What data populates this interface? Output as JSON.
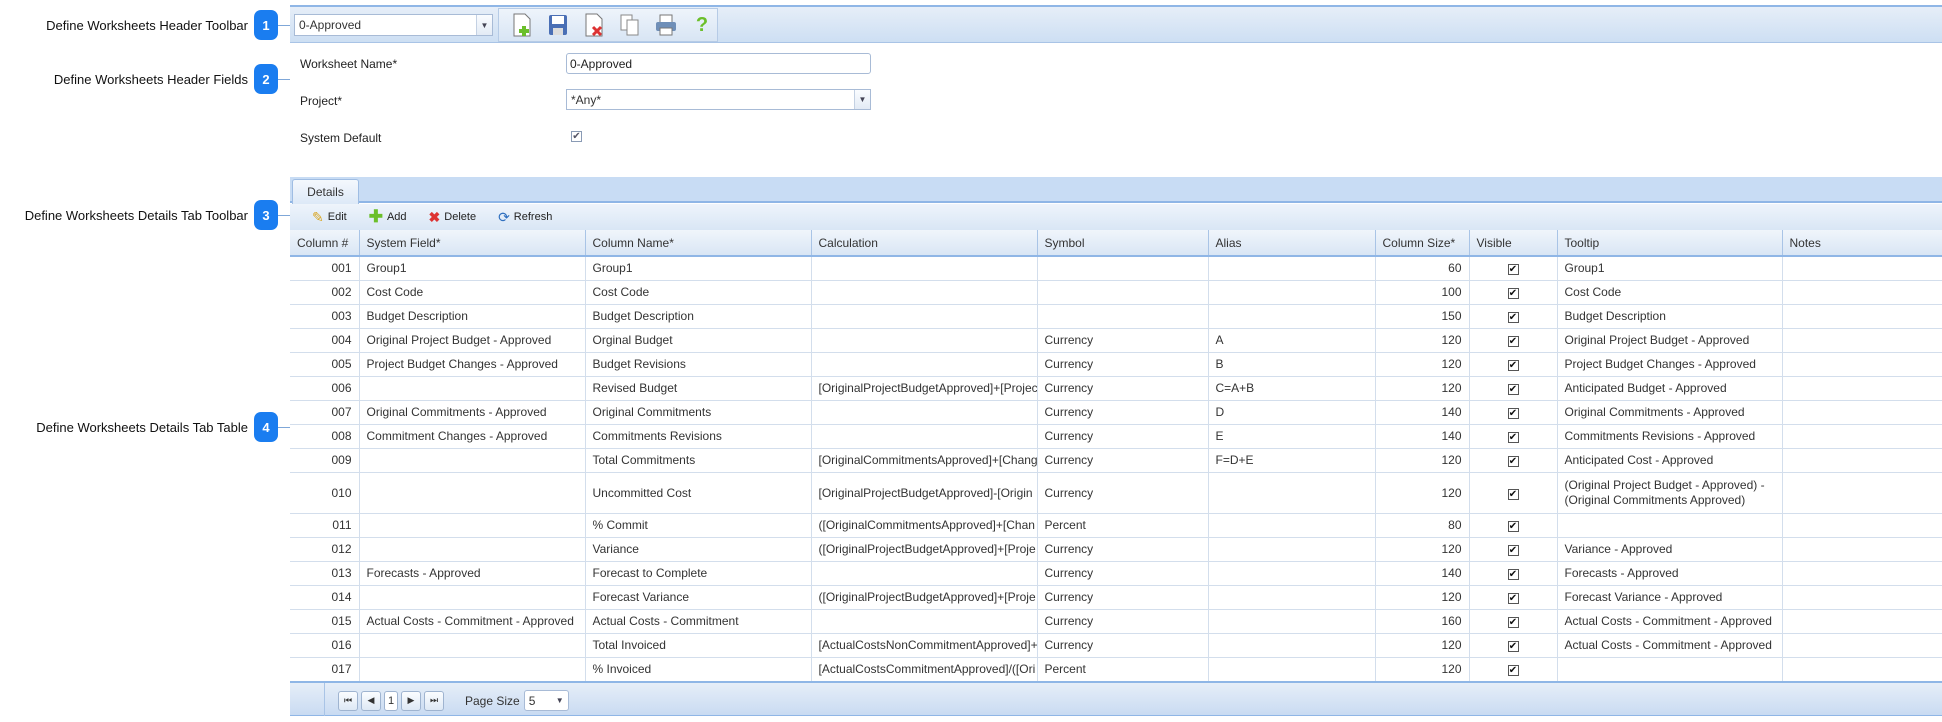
{
  "callouts": [
    {
      "number": "1",
      "label": "Define Worksheets Header Toolbar"
    },
    {
      "number": "2",
      "label": "Define Worksheets Header Fields"
    },
    {
      "number": "3",
      "label": "Define Worksheets Details Tab Toolbar"
    },
    {
      "number": "4",
      "label": "Define Worksheets Details Tab Table"
    }
  ],
  "header_toolbar": {
    "worksheet_select": "0-Approved",
    "icons": [
      "new-document-icon",
      "save-icon",
      "delete-document-icon",
      "copy-icon",
      "print-icon",
      "help-icon"
    ]
  },
  "header_fields": {
    "worksheet_name_label": "Worksheet Name*",
    "worksheet_name_value": "0-Approved",
    "project_label": "Project*",
    "project_value": "*Any*",
    "system_default_label": "System Default",
    "system_default_checked": true
  },
  "tabs": [
    {
      "label": "Details",
      "active": true
    }
  ],
  "details_toolbar": {
    "edit": "Edit",
    "add": "Add",
    "delete": "Delete",
    "refresh": "Refresh"
  },
  "table": {
    "columns": [
      "Column #",
      "System Field*",
      "Column Name*",
      "Calculation",
      "Symbol",
      "Alias",
      "Column Size*",
      "Visible",
      "Tooltip",
      "Notes"
    ],
    "rows": [
      {
        "num": "001",
        "system_field": "Group1",
        "column_name": "Group1",
        "calculation": "",
        "symbol": "",
        "alias": "",
        "size": "60",
        "visible": true,
        "tooltip": "Group1",
        "notes": ""
      },
      {
        "num": "002",
        "system_field": "Cost Code",
        "column_name": "Cost Code",
        "calculation": "",
        "symbol": "",
        "alias": "",
        "size": "100",
        "visible": true,
        "tooltip": "Cost Code",
        "notes": ""
      },
      {
        "num": "003",
        "system_field": "Budget Description",
        "column_name": "Budget Description",
        "calculation": "",
        "symbol": "",
        "alias": "",
        "size": "150",
        "visible": true,
        "tooltip": "Budget Description",
        "notes": ""
      },
      {
        "num": "004",
        "system_field": "Original Project Budget - Approved",
        "column_name": "Orginal Budget",
        "calculation": "",
        "symbol": "Currency",
        "alias": "A",
        "size": "120",
        "visible": true,
        "tooltip": "Original Project Budget - Approved",
        "notes": ""
      },
      {
        "num": "005",
        "system_field": "Project Budget Changes - Approved",
        "column_name": "Budget Revisions",
        "calculation": "",
        "symbol": "Currency",
        "alias": "B",
        "size": "120",
        "visible": true,
        "tooltip": "Project Budget Changes - Approved",
        "notes": ""
      },
      {
        "num": "006",
        "system_field": "",
        "column_name": "Revised Budget",
        "calculation": "[OriginalProjectBudgetApproved]+[Projec",
        "symbol": "Currency",
        "alias": "C=A+B",
        "size": "120",
        "visible": true,
        "tooltip": "Anticipated Budget - Approved",
        "notes": ""
      },
      {
        "num": "007",
        "system_field": "Original Commitments - Approved",
        "column_name": "Original Commitments",
        "calculation": "",
        "symbol": "Currency",
        "alias": "D",
        "size": "140",
        "visible": true,
        "tooltip": "Original Commitments - Approved",
        "notes": ""
      },
      {
        "num": "008",
        "system_field": "Commitment Changes - Approved",
        "column_name": "Commitments Revisions",
        "calculation": "",
        "symbol": "Currency",
        "alias": "E",
        "size": "140",
        "visible": true,
        "tooltip": "Commitments Revisions - Approved",
        "notes": ""
      },
      {
        "num": "009",
        "system_field": "",
        "column_name": "Total Commitments",
        "calculation": "[OriginalCommitmentsApproved]+[Chang",
        "symbol": "Currency",
        "alias": "F=D+E",
        "size": "120",
        "visible": true,
        "tooltip": "Anticipated Cost - Approved",
        "notes": ""
      },
      {
        "num": "010",
        "system_field": "",
        "column_name": "Uncommitted Cost",
        "calculation": "[OriginalProjectBudgetApproved]-[Origin",
        "symbol": "Currency",
        "alias": "",
        "size": "120",
        "visible": true,
        "tooltip": "(Original Project Budget - Approved) - (Original Commitments Approved)",
        "notes": ""
      },
      {
        "num": "011",
        "system_field": "",
        "column_name": "% Commit",
        "calculation": "([OriginalCommitmentsApproved]+[Chan",
        "symbol": "Percent",
        "alias": "",
        "size": "80",
        "visible": true,
        "tooltip": "",
        "notes": ""
      },
      {
        "num": "012",
        "system_field": "",
        "column_name": "Variance",
        "calculation": "([OriginalProjectBudgetApproved]+[Proje",
        "symbol": "Currency",
        "alias": "",
        "size": "120",
        "visible": true,
        "tooltip": "Variance - Approved",
        "notes": ""
      },
      {
        "num": "013",
        "system_field": "Forecasts - Approved",
        "column_name": "Forecast to Complete",
        "calculation": "",
        "symbol": "Currency",
        "alias": "",
        "size": "140",
        "visible": true,
        "tooltip": "Forecasts - Approved",
        "notes": ""
      },
      {
        "num": "014",
        "system_field": "",
        "column_name": "Forecast Variance",
        "calculation": "([OriginalProjectBudgetApproved]+[Proje",
        "symbol": "Currency",
        "alias": "",
        "size": "120",
        "visible": true,
        "tooltip": "Forecast Variance - Approved",
        "notes": ""
      },
      {
        "num": "015",
        "system_field": "Actual Costs - Commitment - Approved",
        "column_name": "Actual Costs - Commitment",
        "calculation": "",
        "symbol": "Currency",
        "alias": "",
        "size": "160",
        "visible": true,
        "tooltip": "Actual Costs - Commitment - Approved",
        "notes": ""
      },
      {
        "num": "016",
        "system_field": "",
        "column_name": "Total Invoiced",
        "calculation": "[ActualCostsNonCommitmentApproved]+",
        "symbol": "Currency",
        "alias": "",
        "size": "120",
        "visible": true,
        "tooltip": "Actual Costs - Commitment - Approved",
        "notes": ""
      },
      {
        "num": "017",
        "system_field": "",
        "column_name": "% Invoiced",
        "calculation": "[ActualCostsCommitmentApproved]/([Ori",
        "symbol": "Percent",
        "alias": "",
        "size": "120",
        "visible": true,
        "tooltip": "",
        "notes": ""
      }
    ]
  },
  "pager": {
    "current_page": "1",
    "page_size_label": "Page Size",
    "page_size": "5"
  },
  "colors": {
    "accent": "#1a7df0",
    "band": "#cddff3",
    "border": "#8fb6e6"
  }
}
